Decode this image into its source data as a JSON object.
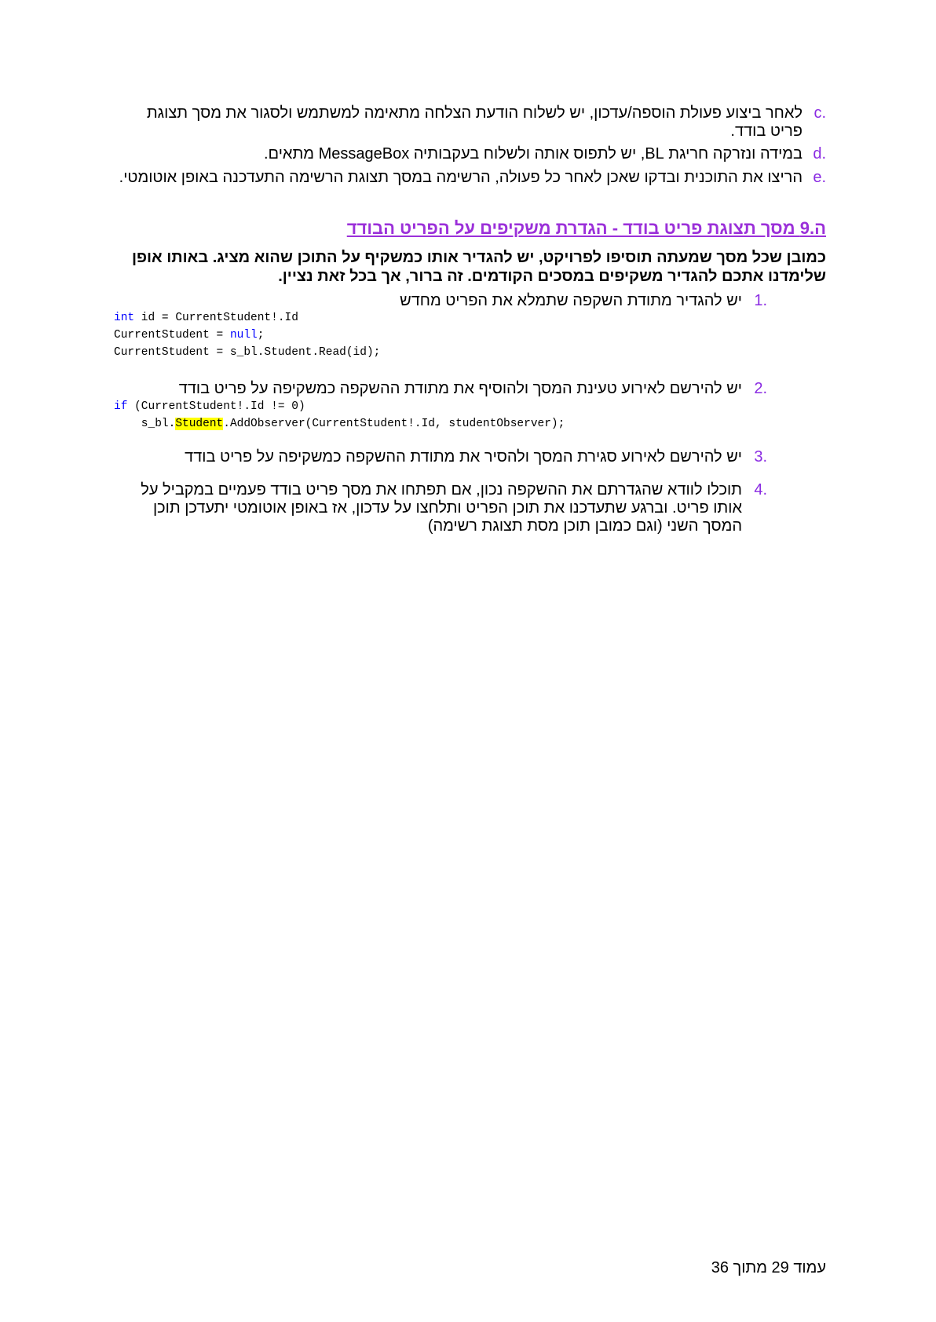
{
  "list_top": {
    "c": {
      "marker": ".c",
      "text": "לאחר ביצוע פעולת הוספה/עדכון, יש לשלוח הודעת הצלחה מתאימה למשתמש ולסגור את מסך תצוגת פריט בודד."
    },
    "d": {
      "marker": ".d",
      "text": "במידה ונזרקה חריגת BL, יש לתפוס אותה ולשלוח בעקבותיה MessageBox מתאים."
    },
    "e": {
      "marker": ".e",
      "text": "הריצו את התוכנית ובדקו שאכן לאחר כל פעולה, הרשימה במסך תצוגת הרשימה התעדכנה באופן אוטומטי."
    }
  },
  "section": {
    "heading": "ה.9 מסך תצוגת פריט בודד - הגדרת משקיפים על הפריט הבודד",
    "intro": "כמובן שכל מסך שמעתה תוסיפו לפרויקט, יש להגדיר אותו כמשקיף על התוכן שהוא מציג. באותו אופן שלימדנו אתכם להגדיר משקיפים במסכים הקודמים. זה ברור, אך בכל זאת נציין."
  },
  "steps": [
    {
      "marker": ".1",
      "text": "יש להגדיר מתודת השקפה שתמלא את הפריט מחדש"
    },
    {
      "marker": ".2",
      "text": "יש להירשם לאירוע טעינת המסך ולהוסיף את מתודת ההשקפה כמשקיפה על פריט בודד"
    },
    {
      "marker": ".3",
      "text": "יש להירשם לאירוע סגירת המסך ולהסיר את מתודת ההשקפה כמשקיפה על פריט בודד"
    },
    {
      "marker": ".4",
      "text": "תוכלו לוודא שהגדרתם את ההשקפה נכון, אם תפתחו את מסך פריט בודד פעמיים במקביל על אותו פריט. וברגע שתעדכנו את תוכן הפריט ותלחצו על עדכון, אז באופן אוטומטי יתעדכן תוכן המסך השני (וגם כמובן תוכן מסת תצוגת רשימה)"
    }
  ],
  "code1": {
    "l1_kw": "int",
    "l1_rest": " id = CurrentStudent!.Id",
    "l2_a": "CurrentStudent = ",
    "l2_kw": "null",
    "l2_b": ";",
    "l3": "CurrentStudent = s_bl.Student.Read(id);"
  },
  "code2": {
    "l1_kw": "if",
    "l1_rest": " (CurrentStudent!.Id != 0)",
    "l2_a": "    s_bl.",
    "l2_hl": "Student",
    "l2_b": ".AddObserver(CurrentStudent!.Id, studentObserver);"
  },
  "footer": "עמוד 29 מתוך 36"
}
